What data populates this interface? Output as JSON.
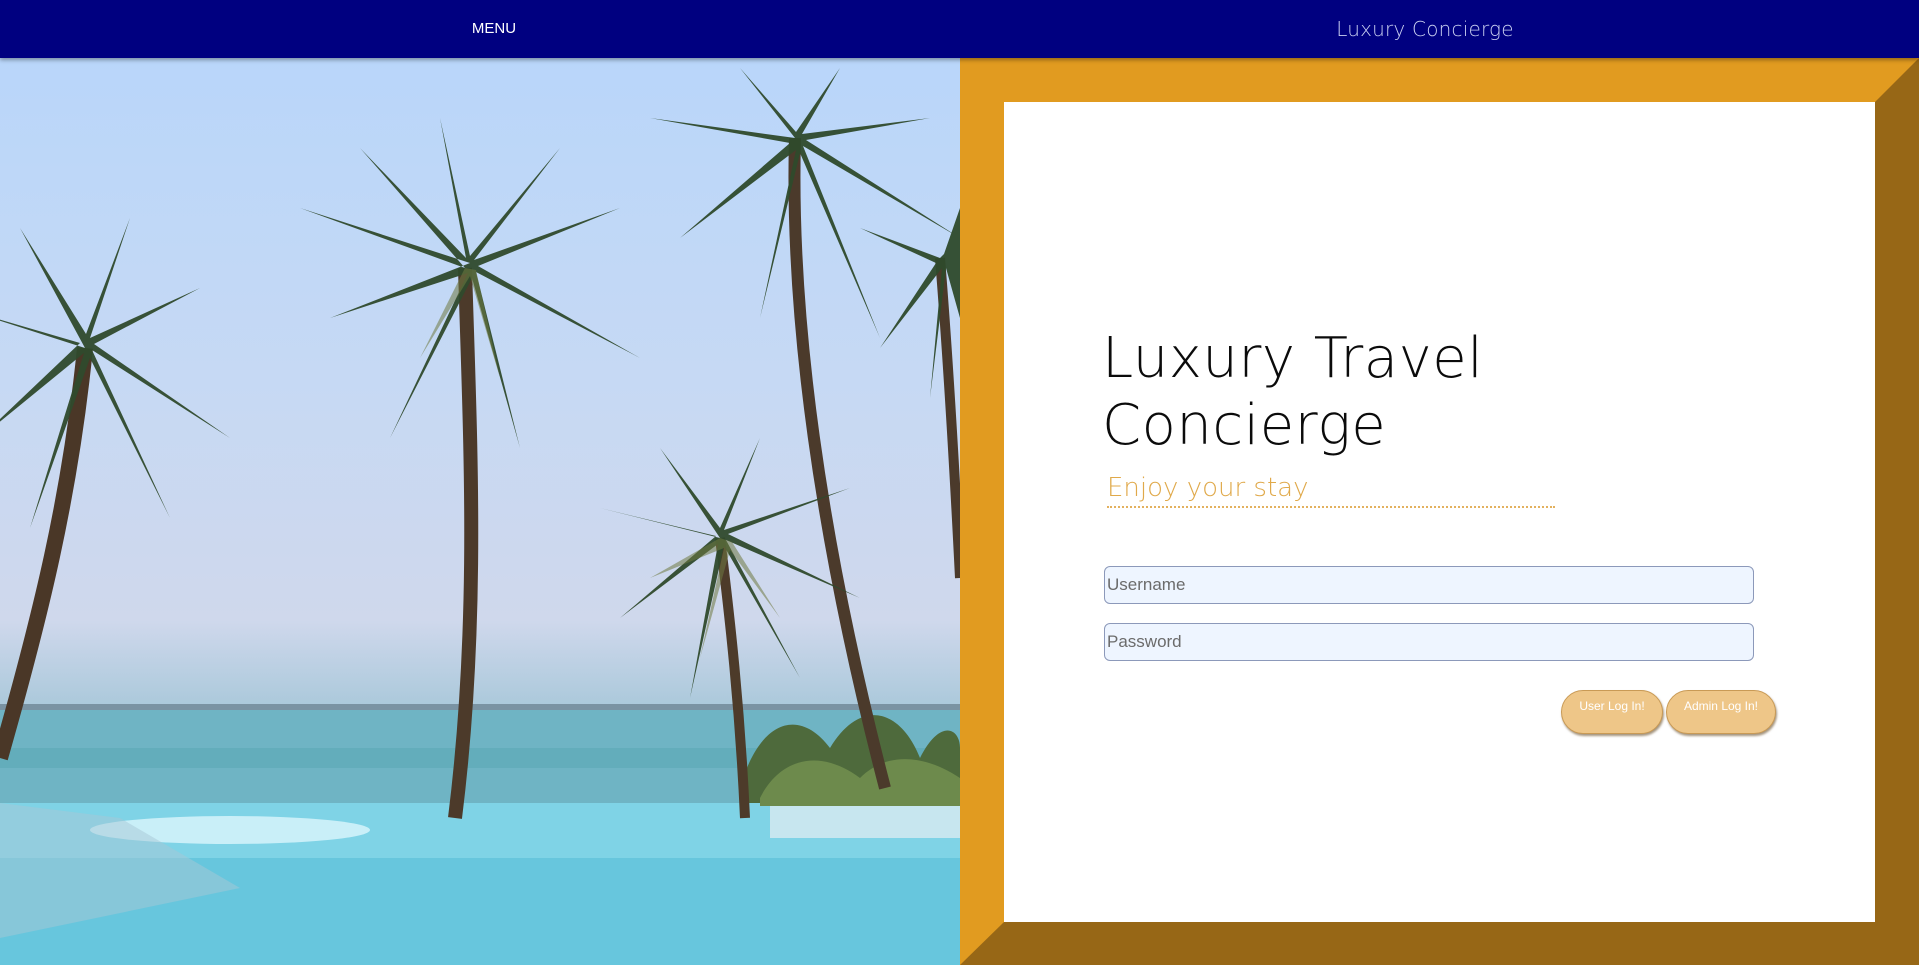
{
  "header": {
    "menu_label": "MENU",
    "brand": "Luxury Concierge",
    "background": "#000080"
  },
  "hero_image": {
    "alt": "Palm trees beside an infinity pool overlooking the ocean"
  },
  "login": {
    "title": "Luxury Travel Concierge",
    "subtitle": "Enjoy your stay",
    "username_placeholder": "Username",
    "password_placeholder": "Password",
    "user_button": "User Log In!",
    "admin_button": "Admin Log In!"
  },
  "colors": {
    "frame": "#e19b20",
    "frame_shadow": "#976716",
    "subtitle": "#e0a94a",
    "button": "#eec688",
    "input_bg": "#eef5ff"
  }
}
